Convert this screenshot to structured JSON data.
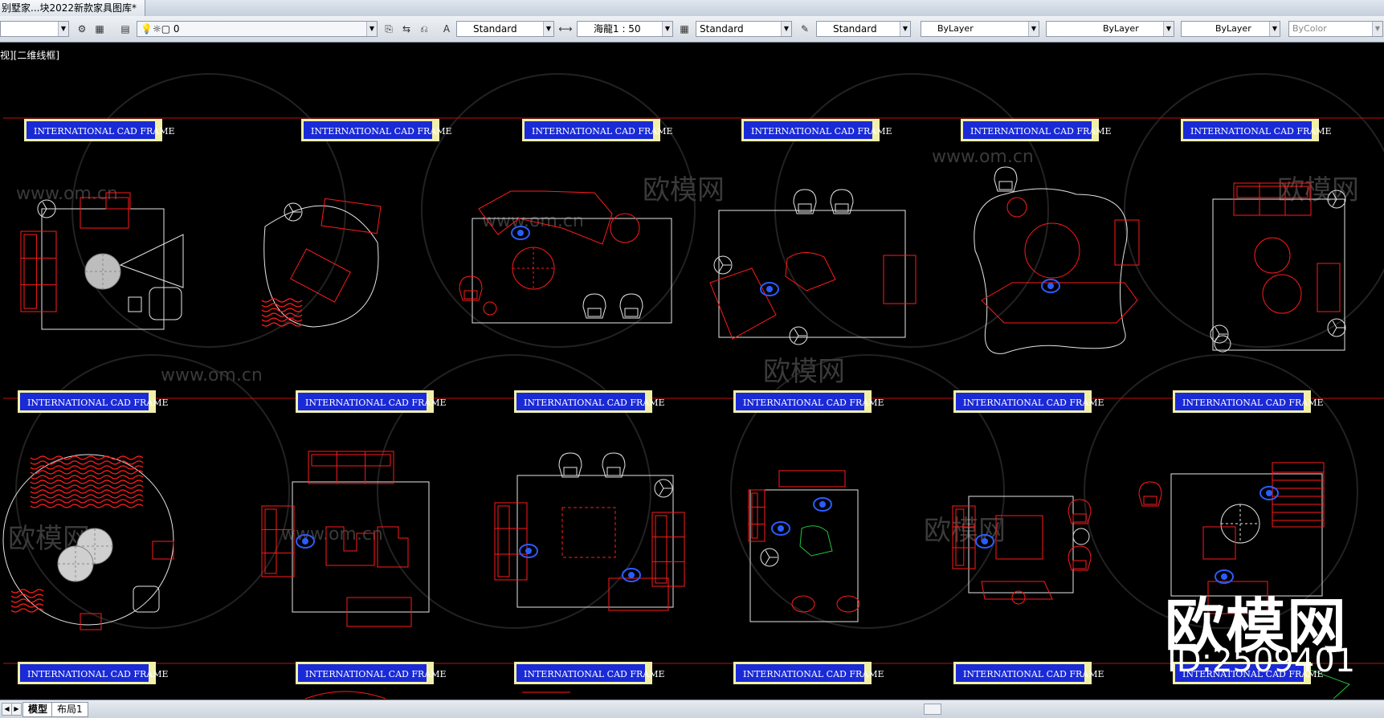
{
  "window": {
    "tab_title": "别墅家...块2022新款家具图库*"
  },
  "toolbar": {
    "layer_value": "",
    "layer_zero": "0",
    "text_style": "Standard",
    "dim_scale": "海龍1 : 50",
    "dim_style": "Standard",
    "table_style": "Standard",
    "color": "ByLayer",
    "linetype": "ByLayer",
    "lineweight": "ByLayer",
    "plot_style": "ByColor"
  },
  "viewport_label": "视][二维线框]",
  "frame_label": "INTERNATIONAL CAD FRAME",
  "watermarks": {
    "om_url": "www.om.cn",
    "om_cn": "欧模网",
    "big": "欧模网",
    "id": "ID:2509401"
  },
  "layout_tabs": [
    {
      "label": "模型"
    },
    {
      "label": "布局1"
    }
  ],
  "colors": {
    "background": "#000000",
    "frame_blue": "#1a2ad6",
    "frame_yellow": "#f2f0a8",
    "drawing_red": "#ff1a1a",
    "drawing_white": "#e6e6e6",
    "accent_blue": "#2a5cff",
    "green": "#21c53a"
  }
}
